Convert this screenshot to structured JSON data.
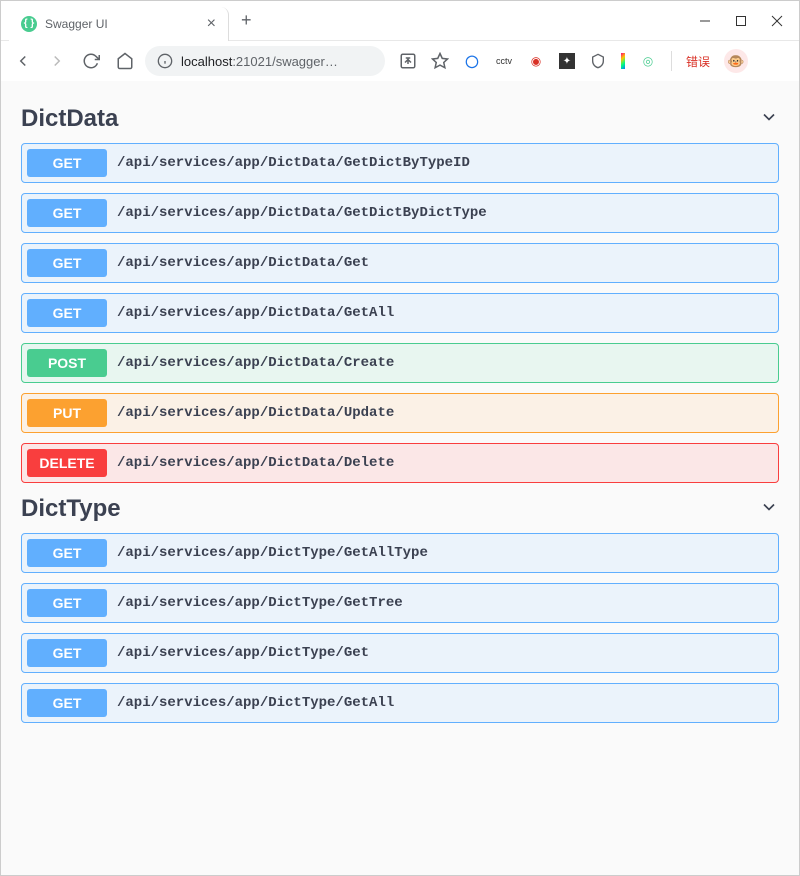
{
  "browser": {
    "tab_title": "Swagger UI",
    "url_host": "localhost",
    "url_port": ":21021",
    "url_path": "/swagger…",
    "error_badge": "错误"
  },
  "sections": [
    {
      "name": "DictData",
      "operations": [
        {
          "method": "GET",
          "path": "/api/services/app/DictData/GetDictByTypeID",
          "cls": "op-get"
        },
        {
          "method": "GET",
          "path": "/api/services/app/DictData/GetDictByDictType",
          "cls": "op-get"
        },
        {
          "method": "GET",
          "path": "/api/services/app/DictData/Get",
          "cls": "op-get"
        },
        {
          "method": "GET",
          "path": "/api/services/app/DictData/GetAll",
          "cls": "op-get"
        },
        {
          "method": "POST",
          "path": "/api/services/app/DictData/Create",
          "cls": "op-post"
        },
        {
          "method": "PUT",
          "path": "/api/services/app/DictData/Update",
          "cls": "op-put"
        },
        {
          "method": "DELETE",
          "path": "/api/services/app/DictData/Delete",
          "cls": "op-delete"
        }
      ]
    },
    {
      "name": "DictType",
      "operations": [
        {
          "method": "GET",
          "path": "/api/services/app/DictType/GetAllType",
          "cls": "op-get"
        },
        {
          "method": "GET",
          "path": "/api/services/app/DictType/GetTree",
          "cls": "op-get"
        },
        {
          "method": "GET",
          "path": "/api/services/app/DictType/Get",
          "cls": "op-get"
        },
        {
          "method": "GET",
          "path": "/api/services/app/DictType/GetAll",
          "cls": "op-get"
        }
      ]
    }
  ]
}
